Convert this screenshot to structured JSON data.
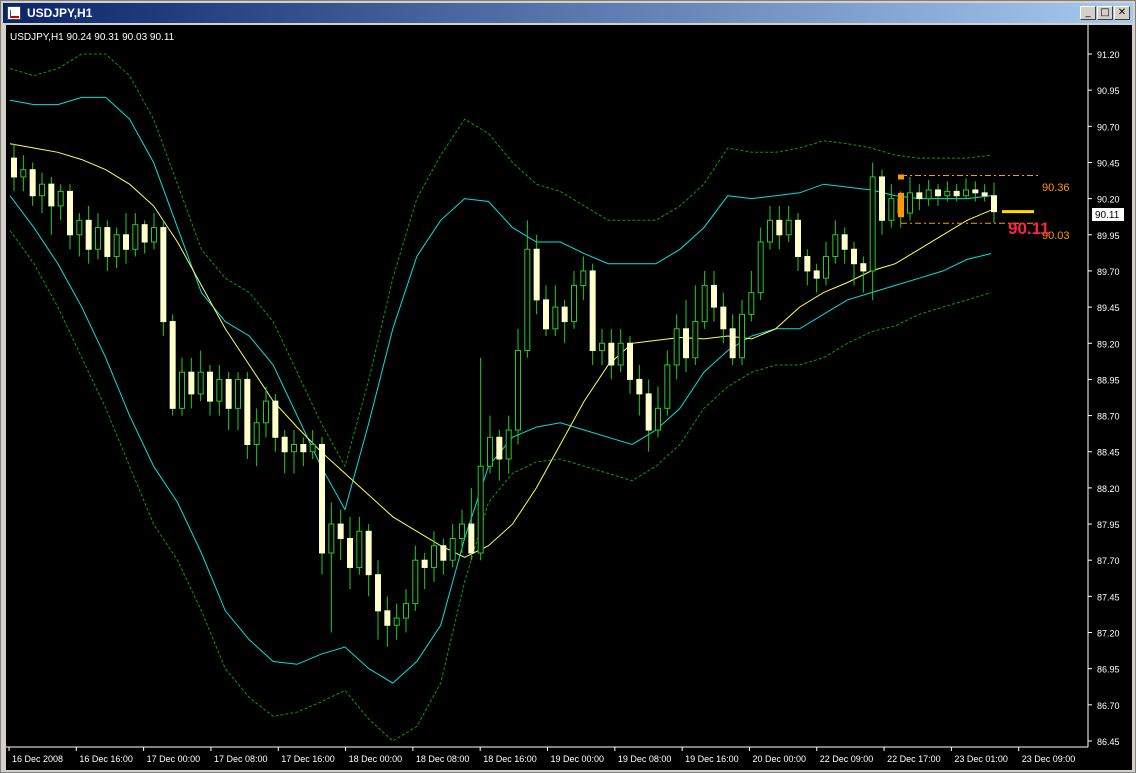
{
  "window": {
    "title": "USDJPY,H1",
    "buttons": [
      {
        "name": "minimize-button",
        "glyph": "_"
      },
      {
        "name": "maximize-button",
        "glyph": "□"
      },
      {
        "name": "close-button",
        "glyph": "✕"
      }
    ]
  },
  "chart_info": "USDJPY,H1  90.24 90.31 90.03 90.11",
  "colors": {
    "background": "#000000",
    "axis": "#ffffff",
    "bull_candle": "#ffffcc",
    "wick": "#22cc22",
    "moving_average": "#ffff55",
    "bollinger_inner": "#00e0e0",
    "bollinger_outer": "#00a000",
    "fib": "#ff9900",
    "price_box": "#ffffff",
    "big_price": "#ff2244"
  },
  "price_label": "90.11",
  "big_price_text": "90.11",
  "fib_high_label": "90.36",
  "fib_low_label": "90.03",
  "chart_data": {
    "type": "candlestick",
    "symbol": "USDJPY",
    "timeframe": "H1",
    "ylim": [
      86.45,
      91.2
    ],
    "y_ticks": [
      "91.20",
      "90.95",
      "90.70",
      "90.45",
      "90.20",
      "89.95",
      "89.70",
      "89.45",
      "89.20",
      "88.95",
      "88.70",
      "88.45",
      "88.20",
      "87.95",
      "87.70",
      "87.45",
      "87.20",
      "86.95",
      "86.70",
      "86.45"
    ],
    "x_ticks": [
      "16 Dec 2008",
      "16 Dec 16:00",
      "17 Dec 00:00",
      "17 Dec 08:00",
      "17 Dec 16:00",
      "18 Dec 00:00",
      "18 Dec 08:00",
      "18 Dec 16:00",
      "19 Dec 00:00",
      "19 Dec 08:00",
      "19 Dec 16:00",
      "20 Dec 00:00",
      "22 Dec 09:00",
      "22 Dec 17:00",
      "23 Dec 01:00",
      "23 Dec 09:00"
    ],
    "last_price": 90.11,
    "fib_levels": [
      90.36,
      90.03
    ],
    "ma_path": [
      90.58,
      90.55,
      90.52,
      90.47,
      90.4,
      90.3,
      90.15,
      89.9,
      89.6,
      89.3,
      89.05,
      88.8,
      88.62,
      88.45,
      88.3,
      88.15,
      88.0,
      87.9,
      87.8,
      87.72,
      87.8,
      87.95,
      88.2,
      88.5,
      88.8,
      89.05,
      89.2,
      89.22,
      89.24,
      89.23,
      89.25,
      89.23,
      89.3,
      89.45,
      89.55,
      89.62,
      89.7,
      89.75,
      89.85,
      89.95,
      90.05,
      90.12
    ],
    "bb_upper_inner": [
      90.88,
      90.85,
      90.85,
      90.9,
      90.9,
      90.75,
      90.45,
      90.0,
      89.55,
      89.35,
      89.25,
      89.05,
      88.7,
      88.35,
      88.05,
      88.65,
      89.3,
      89.8,
      90.05,
      90.2,
      90.18,
      90.0,
      89.9,
      89.9,
      89.82,
      89.75,
      89.75,
      89.75,
      89.85,
      90.0,
      90.22,
      90.2,
      90.22,
      90.24,
      90.3,
      90.28,
      90.26,
      90.22,
      90.2,
      90.2,
      90.2,
      90.22
    ],
    "bb_lower_inner": [
      90.22,
      90.0,
      89.75,
      89.45,
      89.1,
      88.7,
      88.35,
      88.1,
      87.75,
      87.35,
      87.15,
      87.0,
      86.98,
      87.05,
      87.1,
      86.95,
      86.85,
      87.0,
      87.25,
      87.85,
      88.35,
      88.55,
      88.62,
      88.65,
      88.6,
      88.55,
      88.5,
      88.6,
      88.75,
      89.0,
      89.15,
      89.25,
      89.3,
      89.3,
      89.4,
      89.5,
      89.55,
      89.6,
      89.65,
      89.7,
      89.78,
      89.82
    ],
    "bb_upper_outer": [
      91.1,
      91.05,
      91.1,
      91.2,
      91.2,
      91.05,
      90.75,
      90.3,
      89.85,
      89.65,
      89.55,
      89.35,
      89.0,
      88.65,
      88.35,
      88.95,
      89.65,
      90.2,
      90.5,
      90.75,
      90.65,
      90.45,
      90.3,
      90.25,
      90.15,
      90.05,
      90.05,
      90.05,
      90.15,
      90.3,
      90.55,
      90.52,
      90.52,
      90.55,
      90.6,
      90.58,
      90.55,
      90.5,
      90.48,
      90.48,
      90.48,
      90.5
    ],
    "bb_lower_outer": [
      89.98,
      89.75,
      89.45,
      89.1,
      88.75,
      88.35,
      87.95,
      87.7,
      87.35,
      86.95,
      86.75,
      86.62,
      86.65,
      86.72,
      86.8,
      86.6,
      86.45,
      86.55,
      86.85,
      87.55,
      88.1,
      88.3,
      88.38,
      88.4,
      88.35,
      88.3,
      88.25,
      88.35,
      88.5,
      88.75,
      88.9,
      89.0,
      89.05,
      89.05,
      89.1,
      89.2,
      89.28,
      89.32,
      89.4,
      89.45,
      89.5,
      89.55
    ],
    "candles": [
      [
        90.48,
        90.35,
        90.58,
        90.25
      ],
      [
        90.35,
        90.4,
        90.5,
        90.25
      ],
      [
        90.4,
        90.22,
        90.45,
        90.15
      ],
      [
        90.22,
        90.3,
        90.38,
        90.1
      ],
      [
        90.3,
        90.15,
        90.35,
        89.95
      ],
      [
        90.15,
        90.25,
        90.3,
        90.05
      ],
      [
        90.25,
        89.95,
        90.3,
        89.85
      ],
      [
        89.95,
        90.05,
        90.1,
        89.8
      ],
      [
        90.05,
        89.85,
        90.15,
        89.75
      ],
      [
        89.85,
        90.0,
        90.1,
        89.78
      ],
      [
        90.0,
        89.8,
        90.05,
        89.7
      ],
      [
        89.8,
        89.95,
        90.0,
        89.72
      ],
      [
        89.95,
        89.85,
        90.1,
        89.75
      ],
      [
        89.85,
        90.02,
        90.1,
        89.8
      ],
      [
        90.02,
        89.9,
        90.05,
        89.82
      ],
      [
        89.9,
        90.0,
        90.1,
        89.85
      ],
      [
        90.0,
        89.35,
        90.05,
        89.25
      ],
      [
        89.35,
        88.75,
        89.4,
        88.7
      ],
      [
        88.75,
        89.0,
        89.1,
        88.7
      ],
      [
        89.0,
        88.85,
        89.1,
        88.75
      ],
      [
        88.85,
        89.0,
        89.15,
        88.8
      ],
      [
        89.0,
        88.8,
        89.05,
        88.7
      ],
      [
        88.8,
        88.95,
        89.05,
        88.7
      ],
      [
        88.95,
        88.75,
        89.0,
        88.6
      ],
      [
        88.75,
        88.95,
        89.0,
        88.6
      ],
      [
        88.95,
        88.5,
        89.0,
        88.4
      ],
      [
        88.5,
        88.65,
        88.75,
        88.35
      ],
      [
        88.65,
        88.8,
        88.9,
        88.55
      ],
      [
        88.8,
        88.55,
        88.85,
        88.45
      ],
      [
        88.55,
        88.45,
        88.6,
        88.3
      ],
      [
        88.45,
        88.5,
        88.6,
        88.3
      ],
      [
        88.5,
        88.45,
        88.55,
        88.35
      ],
      [
        88.45,
        88.5,
        88.6,
        88.4
      ],
      [
        88.5,
        87.75,
        88.55,
        87.6
      ],
      [
        87.75,
        87.95,
        88.1,
        87.2
      ],
      [
        87.95,
        87.85,
        88.05,
        87.7
      ],
      [
        87.85,
        87.65,
        88.0,
        87.5
      ],
      [
        87.65,
        87.9,
        88.0,
        87.6
      ],
      [
        87.9,
        87.6,
        87.95,
        87.45
      ],
      [
        87.6,
        87.35,
        87.7,
        87.15
      ],
      [
        87.35,
        87.25,
        87.45,
        87.1
      ],
      [
        87.25,
        87.3,
        87.4,
        87.15
      ],
      [
        87.3,
        87.4,
        87.5,
        87.2
      ],
      [
        87.4,
        87.7,
        87.8,
        87.35
      ],
      [
        87.7,
        87.65,
        87.75,
        87.5
      ],
      [
        87.65,
        87.8,
        87.9,
        87.55
      ],
      [
        87.8,
        87.7,
        87.85,
        87.6
      ],
      [
        87.7,
        87.85,
        87.95,
        87.65
      ],
      [
        87.85,
        87.95,
        88.05,
        87.75
      ],
      [
        87.95,
        87.75,
        88.2,
        87.7
      ],
      [
        87.75,
        88.35,
        89.1,
        87.7
      ],
      [
        88.35,
        88.55,
        88.7,
        88.3
      ],
      [
        88.55,
        88.4,
        88.6,
        88.25
      ],
      [
        88.4,
        88.6,
        88.7,
        88.3
      ],
      [
        88.6,
        89.15,
        89.3,
        88.5
      ],
      [
        89.15,
        89.85,
        90.05,
        89.1
      ],
      [
        89.85,
        89.5,
        89.95,
        89.4
      ],
      [
        89.5,
        89.3,
        89.6,
        89.25
      ],
      [
        89.3,
        89.45,
        89.6,
        89.25
      ],
      [
        89.45,
        89.35,
        89.5,
        89.2
      ],
      [
        89.35,
        89.6,
        89.7,
        89.3
      ],
      [
        89.6,
        89.7,
        89.8,
        89.5
      ],
      [
        89.7,
        89.15,
        89.75,
        89.05
      ],
      [
        89.15,
        89.2,
        89.3,
        89.05
      ],
      [
        89.2,
        89.05,
        89.3,
        88.95
      ],
      [
        89.05,
        89.2,
        89.3,
        89.0
      ],
      [
        89.2,
        88.95,
        89.25,
        88.85
      ],
      [
        88.95,
        88.85,
        89.05,
        88.7
      ],
      [
        88.85,
        88.6,
        88.95,
        88.45
      ],
      [
        88.6,
        88.75,
        88.9,
        88.55
      ],
      [
        88.75,
        89.05,
        89.15,
        88.7
      ],
      [
        89.05,
        89.3,
        89.4,
        88.95
      ],
      [
        89.3,
        89.1,
        89.5,
        89.0
      ],
      [
        89.1,
        89.35,
        89.6,
        89.05
      ],
      [
        89.35,
        89.6,
        89.7,
        89.3
      ],
      [
        89.6,
        89.45,
        89.7,
        89.35
      ],
      [
        89.45,
        89.3,
        89.55,
        89.2
      ],
      [
        89.3,
        89.1,
        89.4,
        89.05
      ],
      [
        89.1,
        89.4,
        89.5,
        89.05
      ],
      [
        89.4,
        89.55,
        89.7,
        89.35
      ],
      [
        89.55,
        89.9,
        90.0,
        89.5
      ],
      [
        89.9,
        90.05,
        90.15,
        89.85
      ],
      [
        90.05,
        89.95,
        90.15,
        89.85
      ],
      [
        89.95,
        90.05,
        90.15,
        89.9
      ],
      [
        90.05,
        89.8,
        90.1,
        89.7
      ],
      [
        89.8,
        89.7,
        89.85,
        89.6
      ],
      [
        89.7,
        89.65,
        89.75,
        89.55
      ],
      [
        89.65,
        89.8,
        89.9,
        89.6
      ],
      [
        89.8,
        89.95,
        90.05,
        89.75
      ],
      [
        89.95,
        89.85,
        90.0,
        89.75
      ],
      [
        89.85,
        89.75,
        89.9,
        89.6
      ],
      [
        89.75,
        89.7,
        89.8,
        89.55
      ],
      [
        89.7,
        90.35,
        90.45,
        89.5
      ],
      [
        90.35,
        90.05,
        90.4,
        89.95
      ],
      [
        90.05,
        90.2,
        90.3,
        90.0
      ],
      [
        90.2,
        90.1,
        90.25,
        90.0
      ],
      [
        90.1,
        90.24,
        90.35,
        90.05
      ],
      [
        90.24,
        90.2,
        90.3,
        90.12
      ],
      [
        90.2,
        90.26,
        90.33,
        90.15
      ],
      [
        90.26,
        90.22,
        90.3,
        90.15
      ],
      [
        90.22,
        90.25,
        90.32,
        90.18
      ],
      [
        90.25,
        90.22,
        90.3,
        90.18
      ],
      [
        90.22,
        90.26,
        90.34,
        90.2
      ],
      [
        90.26,
        90.24,
        90.32,
        90.18
      ],
      [
        90.24,
        90.22,
        90.3,
        90.18
      ],
      [
        90.22,
        90.11,
        90.31,
        90.03
      ]
    ]
  }
}
